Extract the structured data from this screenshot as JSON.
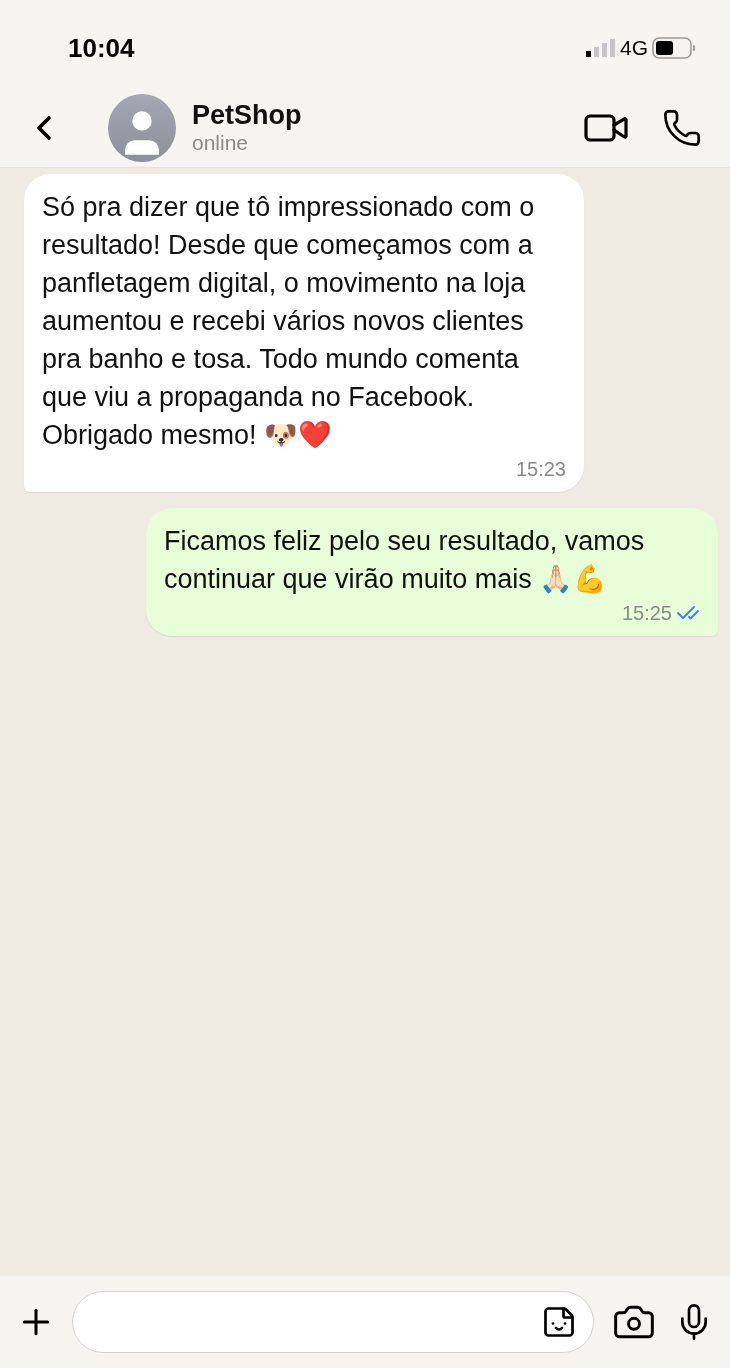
{
  "status_bar": {
    "time": "10:04",
    "network": "4G"
  },
  "header": {
    "name": "PetShop",
    "status": "online"
  },
  "messages": [
    {
      "kind": "incoming",
      "text": "Só pra dizer que tô impressionado com o resultado! Desde que começamos com a panfletagem digital, o movimento na loja aumentou e recebi vários novos clientes pra banho e tosa. Todo mundo comenta que viu a propaganda no Facebook. Obrigado mesmo! 🐶❤️",
      "time": "15:23"
    },
    {
      "kind": "outgoing",
      "text": "Ficamos feliz pelo seu resultado, vamos continuar que virão muito mais 🙏🏻💪",
      "time": "15:25",
      "read": true
    }
  ]
}
